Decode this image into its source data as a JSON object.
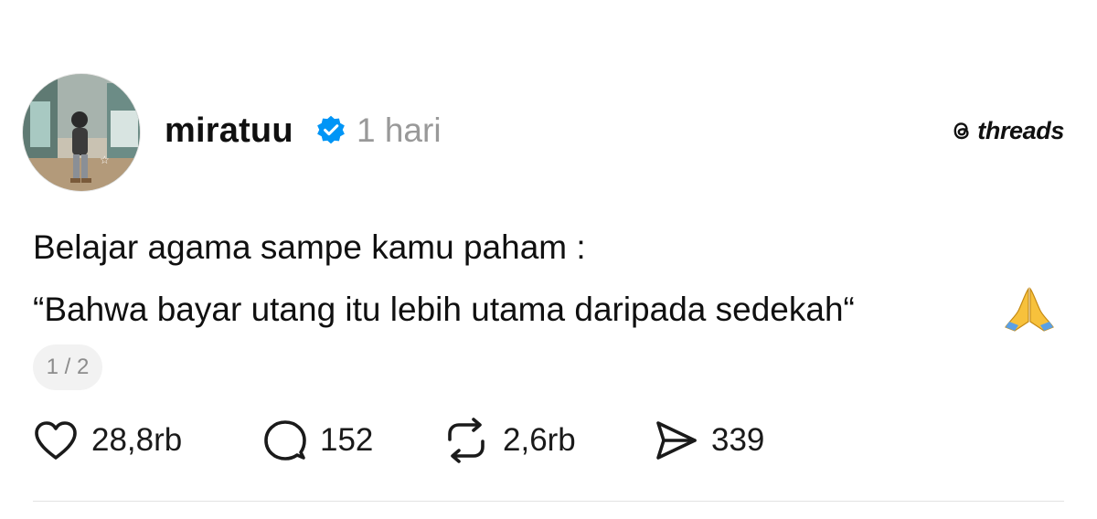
{
  "post": {
    "author": {
      "username": "miratuu",
      "verified": true,
      "timestamp": "1 hari",
      "avatar_icon": "avatar-photo"
    },
    "brand": {
      "name": "threads",
      "logo_icon": "threads-logo-icon"
    },
    "body": {
      "line1": "Belajar agama sampe kamu paham :",
      "line2": "“Bahwa bayar utang itu lebih utama daripada sedekah“",
      "emoji": "🙏"
    },
    "pager": "1 / 2",
    "actions": {
      "like": {
        "icon": "heart-icon",
        "count": "28,8rb"
      },
      "reply": {
        "icon": "comment-bubble-icon",
        "count": "152"
      },
      "repost": {
        "icon": "repost-icon",
        "count": "2,6rb"
      },
      "share": {
        "icon": "send-icon",
        "count": "339"
      }
    },
    "colors": {
      "text": "#101010",
      "muted": "#999999",
      "verified_badge": "#0095f6",
      "pill_bg": "#f2f2f2",
      "divider": "#e2e2e2"
    }
  }
}
